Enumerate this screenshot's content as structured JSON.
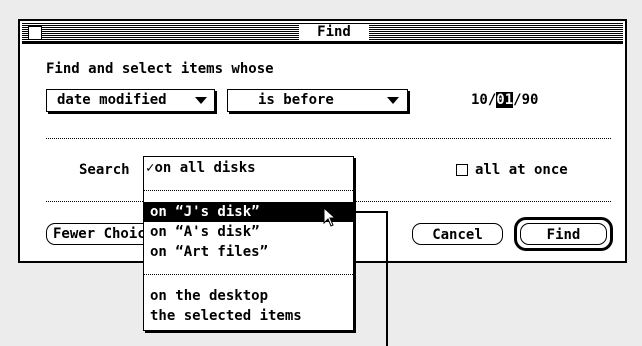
{
  "window": {
    "title": "Find"
  },
  "criteria": {
    "heading": "Find and select items whose",
    "attribute_popup": "date modified",
    "comparison_popup": "is before",
    "date_month": "10/",
    "date_day": "01",
    "date_year": "/90"
  },
  "search": {
    "label": "Search",
    "all_at_once_label": "all at once",
    "menu": {
      "checkmark": "✓",
      "items": [
        "on all disks",
        "on “J's disk”",
        "on “A's disk”",
        "on “Art files”",
        "on the desktop",
        "the selected items"
      ]
    }
  },
  "buttons": {
    "fewer_choices": "Fewer Choices",
    "cancel": "Cancel",
    "find": "Find"
  }
}
